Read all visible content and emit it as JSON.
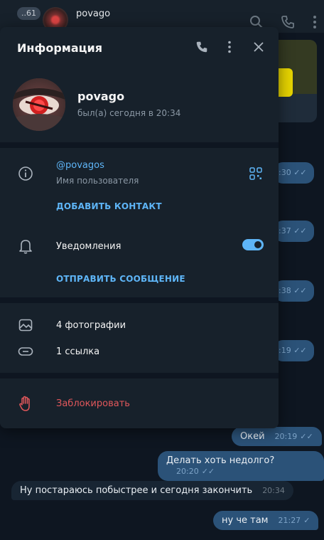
{
  "chat": {
    "unread_count": "..61",
    "title": "povago",
    "messages": [
      {
        "text": "Окей",
        "time": "20:19"
      },
      {
        "text": "Делать хоть недолго?",
        "time": "20:20"
      },
      {
        "text": "Ну постараюсь побыстрее и сегодня закончить",
        "time": "20:34"
      },
      {
        "text": "ну че там",
        "time": "21:27"
      }
    ],
    "hidden_times": [
      ":19",
      ":30",
      ":37",
      ":38",
      ":19"
    ]
  },
  "info": {
    "title": "Информация",
    "name": "povago",
    "status": "был(а) сегодня в 20:34",
    "username": "@povagos",
    "username_caption": "Имя пользователя",
    "add_contact": "ДОБАВИТЬ КОНТАКТ",
    "notifications_label": "Уведомления",
    "notifications_on": true,
    "send_message": "ОТПРАВИТЬ СООБЩЕНИЕ",
    "photos": "4 фотографии",
    "links": "1 ссылка",
    "block": "Заблокировать"
  },
  "colors": {
    "accent": "#5eb5f7",
    "danger": "#e0575b",
    "panel": "#17212b",
    "outgoing_bubble": "#2b5278"
  }
}
